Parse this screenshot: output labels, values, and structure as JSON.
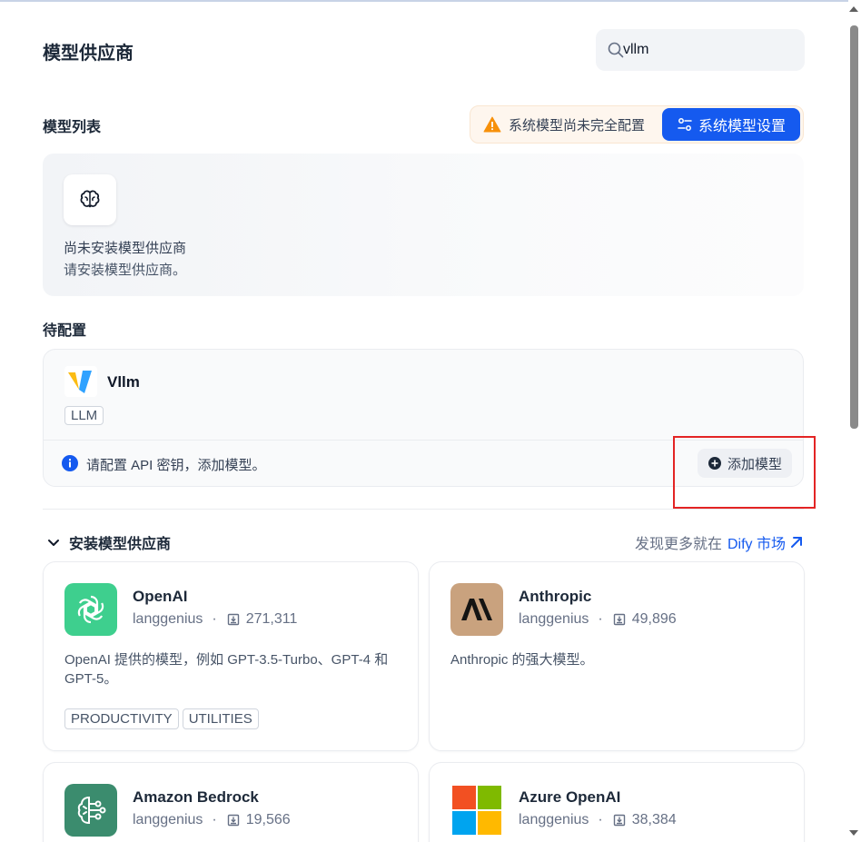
{
  "header": {
    "title": "模型供应商",
    "search_value": "vllm"
  },
  "model_list": {
    "title": "模型列表",
    "warning_text": "系统模型尚未完全配置",
    "system_settings_label": "系统模型设置",
    "empty_title": "尚未安装模型供应商",
    "empty_desc": "请安装模型供应商。"
  },
  "pending": {
    "title": "待配置",
    "provider_name": "Vllm",
    "tag": "LLM",
    "info_text": "请配置 API 密钥，添加模型。",
    "add_model_label": "添加模型"
  },
  "install": {
    "title": "安装模型供应商",
    "market_prefix": "发现更多就在",
    "market_link": "Dify 市场",
    "providers": [
      {
        "name": "OpenAI",
        "author": "langgenius",
        "installs": "271,311",
        "description": "OpenAI 提供的模型，例如 GPT-3.5-Turbo、GPT-4 和 GPT-5。",
        "tags": [
          "PRODUCTIVITY",
          "UTILITIES"
        ],
        "logo_icon": "openai-logo",
        "logo_color": "#3ecf8e"
      },
      {
        "name": "Anthropic",
        "author": "langgenius",
        "installs": "49,896",
        "description": "Anthropic 的强大模型。",
        "tags": [],
        "logo_icon": "anthropic-logo",
        "logo_color": "#c9a27e"
      },
      {
        "name": "Amazon Bedrock",
        "author": "langgenius",
        "installs": "19,566",
        "description": "",
        "tags": [],
        "logo_icon": "bedrock-logo",
        "logo_color": "#3b8c6e"
      },
      {
        "name": "Azure OpenAI",
        "author": "langgenius",
        "installs": "38,384",
        "description": "",
        "tags": [],
        "logo_icon": "microsoft-logo",
        "logo_color": "#f25022"
      }
    ]
  },
  "colors": {
    "primary": "#155aef",
    "warning": "#f79009",
    "highlight_box": "#e32424"
  }
}
